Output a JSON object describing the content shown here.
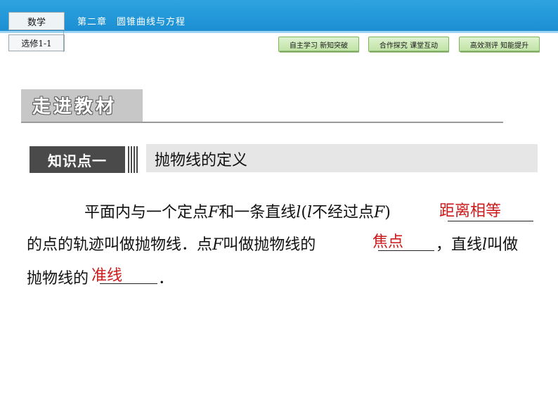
{
  "header": {
    "subject": "数学",
    "chapter": "第二章　圆锥曲线与方程",
    "module": "选修1-1",
    "nav": [
      "自主学习  新知突破",
      "合作探究  课堂互动",
      "高效测评  知能提升"
    ]
  },
  "section": {
    "title": "走进教材"
  },
  "knowledge_point": {
    "tag": "知识点一",
    "title": "抛物线的定义"
  },
  "content": {
    "line1_a": "平面内与一个定点",
    "var_F": "F",
    "line1_b": "和一条直线",
    "var_l": "l",
    "line1_c": "(",
    "var_l2": "l",
    "line1_d": "不经过点",
    "var_F2": "F",
    "line1_e": ")",
    "line2_a": "的点的轨迹叫做抛物线．点",
    "var_F3": "F",
    "line2_b": "叫做抛物线的",
    "line2_c": "，直线",
    "var_l3": "l",
    "line2_d": "叫做",
    "line3_a": "抛物线的",
    "line3_b": "．"
  },
  "answers": {
    "blank1": "距离相等",
    "blank2": "焦点",
    "blank3": "准线"
  }
}
